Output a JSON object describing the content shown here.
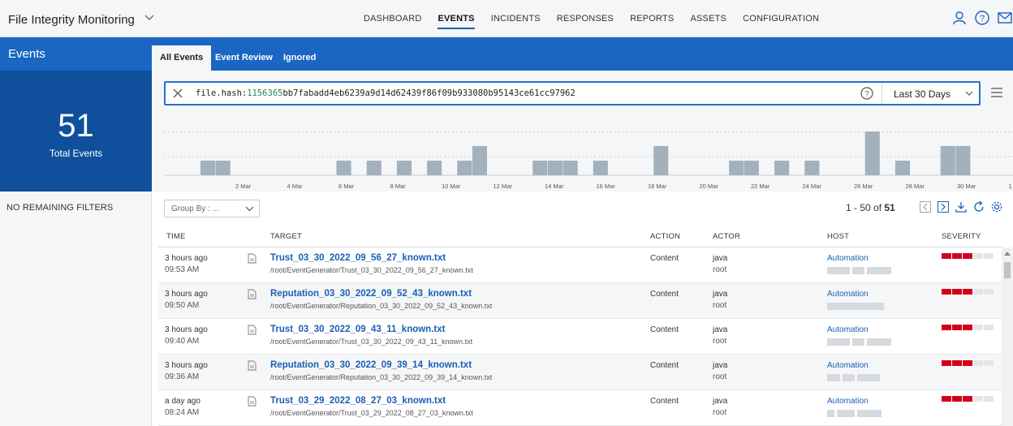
{
  "header": {
    "app_title": "File Integrity Monitoring",
    "nav": [
      "DASHBOARD",
      "EVENTS",
      "INCIDENTS",
      "RESPONSES",
      "REPORTS",
      "ASSETS",
      "CONFIGURATION"
    ],
    "active_nav": "EVENTS",
    "icons": [
      "user-icon",
      "help-icon",
      "mail-icon"
    ]
  },
  "left": {
    "title": "Events",
    "count": "51",
    "count_label": "Total Events",
    "filters_text": "NO REMAINING FILTERS"
  },
  "tabs": [
    "All Events",
    "Event Review",
    "Ignored"
  ],
  "active_tab": "All Events",
  "search": {
    "key": "file.hash:",
    "highlight": "1156365",
    "rest": "bb7fabadd4eb6239a9d14d62439f86f09b933080b95143ce61cc97962",
    "range": "Last 30 Days"
  },
  "histogram": {
    "labels": [
      "2 Mar",
      "4 Mar",
      "6 Mar",
      "8 Mar",
      "10 Mar",
      "12 Mar",
      "14 Mar",
      "16 Mar",
      "18 Mar",
      "20 Mar",
      "22 Mar",
      "24 Mar",
      "26 Mar",
      "28 Mar",
      "30 Mar",
      "1 A"
    ],
    "bar_color": "#a3b1bd",
    "counts": [
      1,
      1,
      0,
      0,
      0,
      0,
      0,
      0,
      0,
      1,
      0,
      1,
      0,
      1,
      0,
      1,
      0,
      1,
      2,
      0,
      0,
      0,
      1,
      1,
      1,
      0,
      1,
      0,
      0,
      0,
      2,
      0,
      0,
      0,
      0,
      1,
      1,
      0,
      1,
      0,
      1,
      0,
      0,
      0,
      3,
      0,
      1,
      0,
      0,
      2,
      2
    ]
  },
  "toolbar": {
    "group_by": "Group By : ...",
    "pager_range": "1 - 50 of ",
    "pager_total": "51"
  },
  "columns": {
    "time": "TIME",
    "target": "TARGET",
    "action": "ACTION",
    "actor": "ACTOR",
    "host": "HOST",
    "severity": "SEVERITY"
  },
  "severity_colors": {
    "high": "#d0021b",
    "low": "#e3e6e9"
  },
  "rows": [
    {
      "ago": "3 hours ago",
      "time": "09:53 AM",
      "name": "Trust_03_30_2022_09_56_27_known.txt",
      "path": "/root/EventGenerator/Trust_03_30_2022_09_56_27_known.txt",
      "action": "Content",
      "actor": "java",
      "user": "root",
      "host": "Automation",
      "severity": 3
    },
    {
      "ago": "3 hours ago",
      "time": "09:50 AM",
      "name": "Reputation_03_30_2022_09_52_43_known.txt",
      "path": "/root/EventGenerator/Reputation_03_30_2022_09_52_43_known.txt",
      "action": "Content",
      "actor": "java",
      "user": "root",
      "host": "Automation",
      "severity": 3
    },
    {
      "ago": "3 hours ago",
      "time": "09:40 AM",
      "name": "Trust_03_30_2022_09_43_11_known.txt",
      "path": "/root/EventGenerator/Trust_03_30_2022_09_43_11_known.txt",
      "action": "Content",
      "actor": "java",
      "user": "root",
      "host": "Automation",
      "severity": 3
    },
    {
      "ago": "3 hours ago",
      "time": "09:36 AM",
      "name": "Reputation_03_30_2022_09_39_14_known.txt",
      "path": "/root/EventGenerator/Reputation_03_30_2022_09_39_14_known.txt",
      "action": "Content",
      "actor": "java",
      "user": "root",
      "host": "Automation",
      "severity": 3
    },
    {
      "ago": "a day ago",
      "time": "08:24 AM",
      "name": "Trust_03_29_2022_08_27_03_known.txt",
      "path": "/root/EventGenerator/Trust_03_29_2022_08_27_03_known.txt",
      "action": "Content",
      "actor": "java",
      "user": "root",
      "host": "Automation",
      "severity": 3
    }
  ]
}
